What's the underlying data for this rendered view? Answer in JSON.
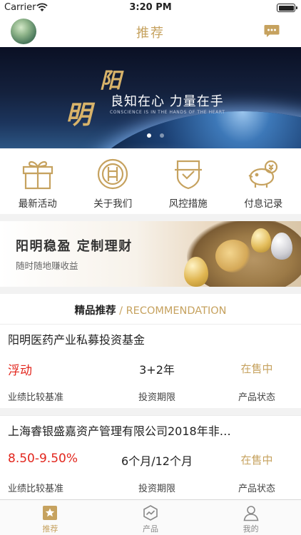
{
  "status_bar": {
    "carrier": "Carrier",
    "time": "3:20 PM",
    "battery_level": 1.0
  },
  "nav": {
    "title": "推荐",
    "left_icon": "avatar",
    "right_icon": "chat-bubble-icon"
  },
  "banner": {
    "calligraphy_top": "阳",
    "calligraphy_bottom": "明",
    "slogan": "良知在心  力量在手",
    "slogan_en": "CONSCIENCE IS IN THE HANDS OF THE HEART",
    "page_count": 2,
    "active_page": 1
  },
  "quick_menu": [
    {
      "label": "最新活动",
      "icon": "gift-icon"
    },
    {
      "label": "关于我们",
      "icon": "company-logo-icon"
    },
    {
      "label": "风控措施",
      "icon": "shield-icon"
    },
    {
      "label": "付息记录",
      "icon": "piggy-bank-icon"
    }
  ],
  "promo": {
    "headline": "阳明稳盈   定制理财",
    "subtitle": "随时随地赚收益"
  },
  "recommendation": {
    "title_cn": "精品推荐",
    "title_en": " / RECOMMENDATION"
  },
  "products": [
    {
      "name": "阳明医药产业私募投资基金",
      "rate": "浮动",
      "term": "3+2年",
      "status": "在售中",
      "rate_label": "业绩比较基准",
      "term_label": "投资期限",
      "status_label": "产品状态"
    },
    {
      "name": "上海睿银盛嘉资产管理有限公司2018年非…",
      "rate": "8.50-9.50%",
      "term": "6个月/12个月",
      "status": "在售中",
      "rate_label": "业绩比较基准",
      "term_label": "投资期限",
      "status_label": "产品状态"
    }
  ],
  "tab_bar": [
    {
      "label": "推荐",
      "icon": "star-icon",
      "active": true
    },
    {
      "label": "产品",
      "icon": "chart-icon",
      "active": false
    },
    {
      "label": "我的",
      "icon": "user-icon",
      "active": false
    }
  ],
  "colors": {
    "accent": "#c6a25f",
    "rate_red": "#e2261d",
    "divider": "#f2f2f2"
  }
}
